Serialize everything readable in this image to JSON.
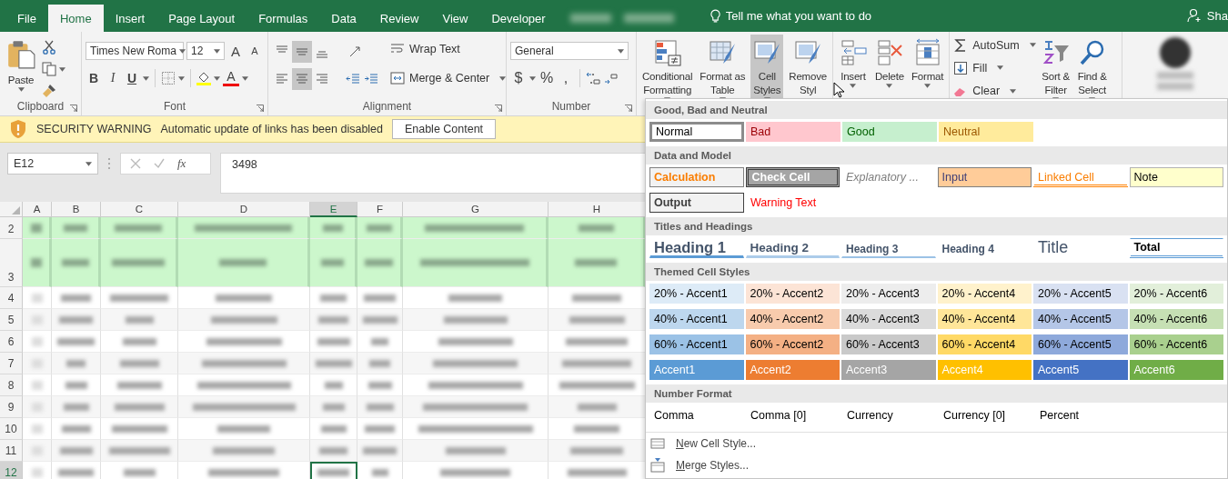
{
  "tabs": [
    {
      "label": "File",
      "selected": false
    },
    {
      "label": "Home",
      "selected": true
    },
    {
      "label": "Insert",
      "selected": false
    },
    {
      "label": "Page Layout",
      "selected": false
    },
    {
      "label": "Formulas",
      "selected": false
    },
    {
      "label": "Data",
      "selected": false
    },
    {
      "label": "Review",
      "selected": false
    },
    {
      "label": "View",
      "selected": false
    },
    {
      "label": "Developer",
      "selected": false
    }
  ],
  "tell_me": {
    "placeholder": "Tell me what you want to do"
  },
  "account": {
    "label": "Sha"
  },
  "clipboard": {
    "paste": "Paste",
    "label": "Clipboard"
  },
  "font": {
    "name": "Times New Roma",
    "size": "12",
    "grow": "A",
    "shrink": "A",
    "bold": "B",
    "italic": "I",
    "underline": "U",
    "font_color_button": "A",
    "label": "Font"
  },
  "alignment": {
    "buttons": [
      {
        "kind": "top",
        "selected": false
      },
      {
        "kind": "middle",
        "selected": true
      },
      {
        "kind": "bottom",
        "selected": false
      },
      {
        "kind": "orientation",
        "selected": false
      },
      {
        "kind": "left",
        "selected": false
      },
      {
        "kind": "center",
        "selected": true
      },
      {
        "kind": "right",
        "selected": false
      },
      {
        "kind": "outdent",
        "selected": false
      },
      {
        "kind": "indent",
        "selected": false
      }
    ],
    "wrap": "Wrap Text",
    "merge": "Merge & Center",
    "label": "Alignment"
  },
  "number": {
    "format": "General",
    "currency": "$",
    "percent": "%",
    "comma": ",",
    "label": "Number"
  },
  "styles": [
    {
      "kind": "conditional",
      "lines": [
        "Conditional",
        "Formatting"
      ],
      "dropdown": true,
      "selected": false
    },
    {
      "kind": "table",
      "lines": [
        "Format as",
        "Table"
      ],
      "dropdown": true,
      "selected": false
    },
    {
      "kind": "cellstyles",
      "lines": [
        "Cell",
        "Styles"
      ],
      "dropdown": true,
      "selected": true
    },
    {
      "kind": "remove",
      "lines": [
        "Remove",
        "Styl"
      ],
      "dropdown": false,
      "selected": false
    }
  ],
  "cells": [
    {
      "kind": "insert",
      "lines": [
        "Insert"
      ],
      "dropdown": true,
      "selected": false
    },
    {
      "kind": "delete",
      "lines": [
        "Delete"
      ],
      "dropdown": true,
      "selected": false
    },
    {
      "kind": "format",
      "lines": [
        "Format"
      ],
      "dropdown": true,
      "selected": false
    }
  ],
  "editing": {
    "small": [
      {
        "kind": "autosum",
        "label": "AutoSum"
      },
      {
        "kind": "fill",
        "label": "Fill"
      },
      {
        "kind": "clear",
        "label": "Clear"
      }
    ],
    "large": [
      {
        "kind": "sort",
        "lines": [
          "Sort &",
          "Filter"
        ],
        "dropdown": true,
        "selected": false
      },
      {
        "kind": "find",
        "lines": [
          "Find &",
          "Select"
        ],
        "dropdown": true,
        "selected": false
      }
    ]
  },
  "security": {
    "title": "SECURITY WARNING",
    "message": "Automatic update of links has been disabled",
    "button": "Enable Content"
  },
  "formula_bar": {
    "name_box": "E12",
    "fx": "fx",
    "value": "3498"
  },
  "sheet": {
    "columns": [
      {
        "label": "A",
        "selected": false
      },
      {
        "label": "B",
        "selected": false
      },
      {
        "label": "C",
        "selected": false
      },
      {
        "label": "D",
        "selected": false
      },
      {
        "label": "E",
        "selected": true
      },
      {
        "label": "F",
        "selected": false
      },
      {
        "label": "G",
        "selected": false
      },
      {
        "label": "H",
        "selected": false
      }
    ],
    "rows": [
      {
        "label": "2",
        "kind": "header",
        "selected": false
      },
      {
        "label": "3",
        "kind": "header",
        "selected": false
      },
      {
        "label": "4",
        "kind": "data",
        "selected": false
      },
      {
        "label": "5",
        "kind": "data",
        "selected": false
      },
      {
        "label": "6",
        "kind": "data",
        "selected": false
      },
      {
        "label": "7",
        "kind": "data",
        "selected": false
      },
      {
        "label": "8",
        "kind": "data",
        "selected": false
      },
      {
        "label": "9",
        "kind": "data",
        "selected": false
      },
      {
        "label": "10",
        "kind": "data",
        "selected": false
      },
      {
        "label": "11",
        "kind": "data",
        "selected": false
      },
      {
        "label": "12",
        "kind": "data",
        "selected": true
      }
    ]
  },
  "cell_styles": {
    "sections": [
      {
        "title": "Good, Bad and Neutral",
        "rows": [
          [
            {
              "label": "Normal",
              "kind": "normal",
              "selected": true
            },
            {
              "label": "Bad",
              "kind": "bad",
              "selected": false
            },
            {
              "label": "Good",
              "kind": "good",
              "selected": false
            },
            {
              "label": "Neutral",
              "kind": "neutral",
              "selected": false
            }
          ]
        ]
      },
      {
        "title": "Data and Model",
        "rows": [
          [
            {
              "label": "Calculation",
              "kind": "calculation",
              "selected": false
            },
            {
              "label": "Check Cell",
              "kind": "check",
              "selected": false
            },
            {
              "label": "Explanatory ...",
              "kind": "explanatory",
              "selected": false
            },
            {
              "label": "Input",
              "kind": "input",
              "selected": false
            },
            {
              "label": "Linked Cell",
              "kind": "linked",
              "selected": false
            },
            {
              "label": "Note",
              "kind": "note",
              "selected": false
            }
          ],
          [
            {
              "label": "Output",
              "kind": "output",
              "selected": false
            },
            {
              "label": "Warning Text",
              "kind": "warning",
              "selected": false
            }
          ]
        ]
      },
      {
        "title": "Titles and Headings",
        "rows": [
          [
            {
              "label": "Heading 1",
              "kind": "h1",
              "selected": false
            },
            {
              "label": "Heading 2",
              "kind": "h2",
              "selected": false
            },
            {
              "label": "Heading 3",
              "kind": "h3",
              "selected": false
            },
            {
              "label": "Heading 4",
              "kind": "h4",
              "selected": false
            },
            {
              "label": "Title",
              "kind": "title",
              "selected": false
            },
            {
              "label": "Total",
              "kind": "total",
              "selected": false
            }
          ]
        ]
      },
      {
        "title": "Themed Cell Styles",
        "rows": [
          [
            {
              "label": "20% - Accent1",
              "kind": "accent",
              "color": "#ddebf7",
              "selected": false
            },
            {
              "label": "20% - Accent2",
              "kind": "accent",
              "color": "#fce4d6",
              "selected": false
            },
            {
              "label": "20% - Accent3",
              "kind": "accent",
              "color": "#ededed",
              "selected": false
            },
            {
              "label": "20% - Accent4",
              "kind": "accent",
              "color": "#fff2cc",
              "selected": false
            },
            {
              "label": "20% - Accent5",
              "kind": "accent",
              "color": "#d9e1f2",
              "selected": false
            },
            {
              "label": "20% - Accent6",
              "kind": "accent",
              "color": "#e2efda",
              "selected": false
            }
          ],
          [
            {
              "label": "40% - Accent1",
              "kind": "accent",
              "color": "#bdd7ee",
              "selected": false
            },
            {
              "label": "40% - Accent2",
              "kind": "accent",
              "color": "#f8cbad",
              "selected": false
            },
            {
              "label": "40% - Accent3",
              "kind": "accent",
              "color": "#dbdbdb",
              "selected": false
            },
            {
              "label": "40% - Accent4",
              "kind": "accent",
              "color": "#ffe699",
              "selected": false
            },
            {
              "label": "40% - Accent5",
              "kind": "accent",
              "color": "#b4c6e7",
              "selected": false
            },
            {
              "label": "40% - Accent6",
              "kind": "accent",
              "color": "#c6e0b4",
              "selected": false
            }
          ],
          [
            {
              "label": "60% - Accent1",
              "kind": "accent",
              "color": "#9bc2e6",
              "selected": false
            },
            {
              "label": "60% - Accent2",
              "kind": "accent",
              "color": "#f4b084",
              "selected": false
            },
            {
              "label": "60% - Accent3",
              "kind": "accent",
              "color": "#c9c9c9",
              "selected": false
            },
            {
              "label": "60% - Accent4",
              "kind": "accent",
              "color": "#ffd966",
              "selected": false
            },
            {
              "label": "60% - Accent5",
              "kind": "accent",
              "color": "#8ea9db",
              "selected": false
            },
            {
              "label": "60% - Accent6",
              "kind": "accent",
              "color": "#a9d08e",
              "selected": false
            }
          ],
          [
            {
              "label": "Accent1",
              "kind": "solid",
              "color": "#5b9bd5",
              "selected": false
            },
            {
              "label": "Accent2",
              "kind": "solid",
              "color": "#ed7d31",
              "selected": false
            },
            {
              "label": "Accent3",
              "kind": "solid",
              "color": "#a5a5a5",
              "selected": false
            },
            {
              "label": "Accent4",
              "kind": "solid",
              "color": "#ffc000",
              "selected": false
            },
            {
              "label": "Accent5",
              "kind": "solid",
              "color": "#4472c4",
              "selected": false
            },
            {
              "label": "Accent6",
              "kind": "solid",
              "color": "#70ad47",
              "selected": false
            }
          ]
        ]
      },
      {
        "title": "Number Format",
        "rows": [
          [
            {
              "label": "Comma",
              "kind": "plain",
              "selected": false
            },
            {
              "label": "Comma [0]",
              "kind": "plain",
              "selected": false
            },
            {
              "label": "Currency",
              "kind": "plain",
              "selected": false
            },
            {
              "label": "Currency [0]",
              "kind": "plain",
              "selected": false
            },
            {
              "label": "Percent",
              "kind": "plain",
              "selected": false
            }
          ]
        ]
      }
    ],
    "menu": [
      {
        "kind": "new",
        "accel": "N",
        "rest": "ew Cell Style..."
      },
      {
        "kind": "merge",
        "accel": "M",
        "rest": "erge Styles..."
      }
    ]
  }
}
